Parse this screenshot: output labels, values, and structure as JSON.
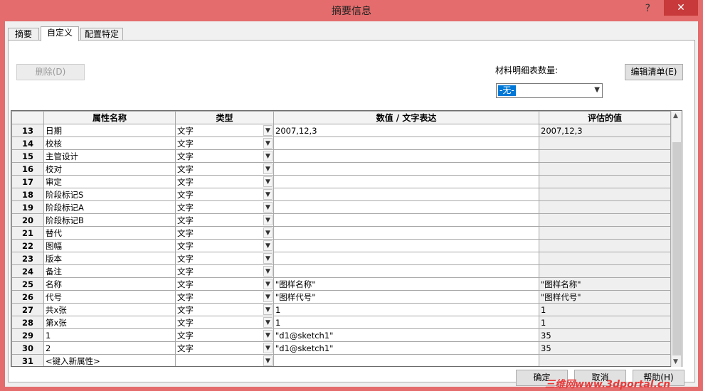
{
  "window": {
    "title": "摘要信息",
    "help_glyph": "?",
    "close_glyph": "✕"
  },
  "tabs": [
    "摘要",
    "自定义",
    "配置特定"
  ],
  "toolbar": {
    "delete_label": "删除(D)",
    "qty_label": "材料明细表数量:",
    "qty_value": "-无-",
    "edit_list_label": "编辑清单(E)"
  },
  "table": {
    "columns": [
      "",
      "属性名称",
      "类型",
      "数值 / 文字表达",
      "评估的值"
    ],
    "rows": [
      {
        "n": "13",
        "name": "日期",
        "type": "文字",
        "value": "2007,12,3",
        "eval": "2007,12,3"
      },
      {
        "n": "14",
        "name": "校核",
        "type": "文字",
        "value": "",
        "eval": ""
      },
      {
        "n": "15",
        "name": "主管设计",
        "type": "文字",
        "value": "",
        "eval": ""
      },
      {
        "n": "16",
        "name": "校对",
        "type": "文字",
        "value": "",
        "eval": ""
      },
      {
        "n": "17",
        "name": "审定",
        "type": "文字",
        "value": "",
        "eval": ""
      },
      {
        "n": "18",
        "name": "阶段标记S",
        "type": "文字",
        "value": "",
        "eval": ""
      },
      {
        "n": "19",
        "name": "阶段标记A",
        "type": "文字",
        "value": "",
        "eval": ""
      },
      {
        "n": "20",
        "name": "阶段标记B",
        "type": "文字",
        "value": "",
        "eval": ""
      },
      {
        "n": "21",
        "name": "替代",
        "type": "文字",
        "value": "",
        "eval": ""
      },
      {
        "n": "22",
        "name": "图幅",
        "type": "文字",
        "value": "",
        "eval": ""
      },
      {
        "n": "23",
        "name": "版本",
        "type": "文字",
        "value": "",
        "eval": ""
      },
      {
        "n": "24",
        "name": "备注",
        "type": "文字",
        "value": "",
        "eval": ""
      },
      {
        "n": "25",
        "name": "名称",
        "type": "文字",
        "value": "\"图样名称\"",
        "eval": "\"图样名称\""
      },
      {
        "n": "26",
        "name": "代号",
        "type": "文字",
        "value": "\"图样代号\"",
        "eval": "\"图样代号\""
      },
      {
        "n": "27",
        "name": "共x张",
        "type": "文字",
        "value": "1",
        "eval": "1"
      },
      {
        "n": "28",
        "name": "第x张",
        "type": "文字",
        "value": "1",
        "eval": "1"
      },
      {
        "n": "29",
        "name": "1",
        "type": "文字",
        "value": "\"d1@sketch1\"",
        "eval": "35"
      },
      {
        "n": "30",
        "name": "2",
        "type": "文字",
        "value": "\"d1@sketch1\"",
        "eval": "35"
      },
      {
        "n": "31",
        "name": "<键入新属性>",
        "type": "",
        "value": "",
        "eval": ""
      }
    ]
  },
  "footer": {
    "ok_label": "确定",
    "cancel_label": "取消",
    "help_label": "帮助(H)"
  },
  "watermark": "三维网www.3dportal.cn",
  "colors": {
    "titlebar": "#e46c6c",
    "close": "#c7393a",
    "selection": "#0078d7"
  }
}
